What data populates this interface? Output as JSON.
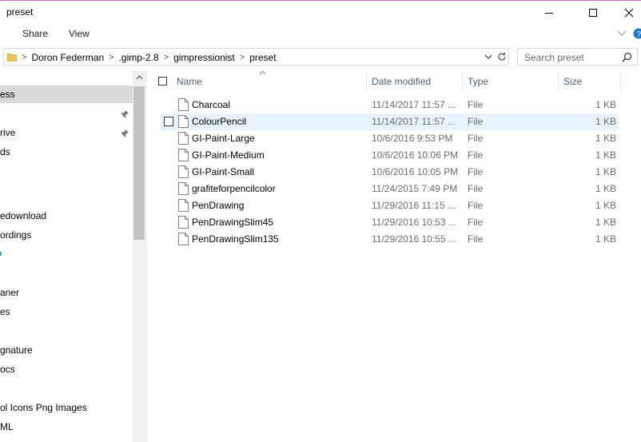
{
  "window": {
    "title": "preset",
    "minimize_icon": "minimize-icon",
    "maximize_icon": "maximize-icon",
    "close_icon": "close-icon"
  },
  "ribbon": {
    "tabs": [
      "Share",
      "View"
    ],
    "expand_icon": "chevron-down-icon",
    "help_icon": "help-icon"
  },
  "address": {
    "crumbs": [
      "Doron Federman",
      ".gimp-2.8",
      "gimpressionist",
      "preset"
    ],
    "separator": ">",
    "refresh_icon": "refresh-icon"
  },
  "search": {
    "placeholder": "Search preset"
  },
  "nav": {
    "items": [
      {
        "label": "ess",
        "selected": true
      },
      {
        "label": "",
        "pinned": true
      },
      {
        "label": "rive",
        "pinned": true
      },
      {
        "label": "ds"
      },
      {
        "label": ""
      },
      {
        "label": ""
      },
      {
        "label": "edownload"
      },
      {
        "label": "ordings"
      },
      {
        "label": ""
      },
      {
        "label": ""
      },
      {
        "label": "aner"
      },
      {
        "label": "es"
      },
      {
        "label": ""
      },
      {
        "label": "gnature"
      },
      {
        "label": "ocs"
      },
      {
        "label": ""
      },
      {
        "label": "ol Icons Png Images"
      },
      {
        "label": "ML"
      }
    ]
  },
  "columns": {
    "name": "Name",
    "date": "Date modified",
    "type": "Type",
    "size": "Size"
  },
  "files": [
    {
      "name": "Charcoal",
      "date": "11/14/2017 11:57 ...",
      "type": "File",
      "size": "1 KB"
    },
    {
      "name": "ColourPencil",
      "date": "11/14/2017 11:57 ...",
      "type": "File",
      "size": "1 KB",
      "hover": true
    },
    {
      "name": "GI-Paint-Large",
      "date": "10/6/2016 9:53 PM",
      "type": "File",
      "size": "1 KB"
    },
    {
      "name": "GI-Paint-Medium",
      "date": "10/6/2016 10:06 PM",
      "type": "File",
      "size": "1 KB"
    },
    {
      "name": "GI-Paint-Small",
      "date": "10/6/2016 10:05 PM",
      "type": "File",
      "size": "1 KB"
    },
    {
      "name": "grafiteforpencilcolor",
      "date": "11/24/2015 7:49 PM",
      "type": "File",
      "size": "1 KB"
    },
    {
      "name": "PenDrawing",
      "date": "11/29/2016 11:15 ...",
      "type": "File",
      "size": "1 KB"
    },
    {
      "name": "PenDrawingSlim45",
      "date": "11/29/2016 10:53 ...",
      "type": "File",
      "size": "1 KB"
    },
    {
      "name": "PenDrawingSlim135",
      "date": "11/29/2016 10:55 ...",
      "type": "File",
      "size": "1 KB"
    }
  ],
  "colors": {
    "selection": "#cce8ff",
    "hover": "#e5f3ff",
    "header_text": "#4c607a",
    "secondary_text": "#6d6d6d"
  }
}
